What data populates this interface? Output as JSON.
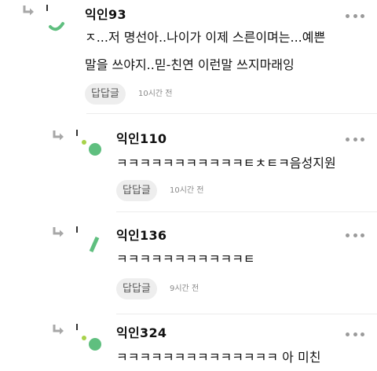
{
  "reply_button_label": "답답글",
  "colors": {
    "avatar_green": "#5fbf7f",
    "avatar_lime": "#a8d24a",
    "icon_gray": "#a7a7a7"
  },
  "comments": [
    {
      "author": "익인93",
      "lines": [
        "ㅈ...저 명선아..나이가 이제 스른이며는...예쁜",
        "말을 쓰야지..믿-친연 이런말 쓰지마래잉"
      ],
      "time": "10시간 전"
    },
    {
      "author": "익인110",
      "lines": [
        "ㅋㅋㅋㅋㅋㅋㅋㅋㅋㅋㅋㅌㅊㅌㅋ음성지원"
      ],
      "time": "10시간 전"
    },
    {
      "author": "익인136",
      "lines": [
        "ㅋㅋㅋㅋㅋㅋㅋㅋㅋㅋㅋㅌ"
      ],
      "time": "9시간 전"
    },
    {
      "author": "익인324",
      "lines": [
        "ㅋㅋㅋㅋㅋㅋㅋㅋㅋㅋㅋㅋㅋㅋ 아 미친"
      ]
    }
  ]
}
